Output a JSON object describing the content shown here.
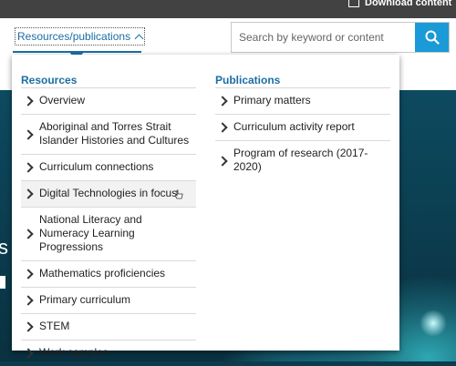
{
  "header": {
    "download_label": "Download content",
    "nav_tab_label": "Resources/publications",
    "search_placeholder": "Search by keyword or content"
  },
  "hero": {
    "partial_heading": "s"
  },
  "dropdown": {
    "resources": {
      "heading": "Resources",
      "items": [
        "Overview",
        "Aboriginal and Torres Strait Islander Histories and Cultures",
        "Curriculum connections",
        "Digital Technologies in focus",
        "National Literacy and Numeracy Learning Progressions",
        "Mathematics proficiencies",
        "Primary curriculum",
        "STEM",
        "Work samples"
      ]
    },
    "publications": {
      "heading": "Publications",
      "items": [
        "Primary matters",
        "Curriculum activity report",
        "Program of research (2017-2020)"
      ]
    }
  },
  "colors": {
    "accent": "#1b6ea3",
    "search_button": "#1a9ad6",
    "header_bar": "#424242"
  }
}
